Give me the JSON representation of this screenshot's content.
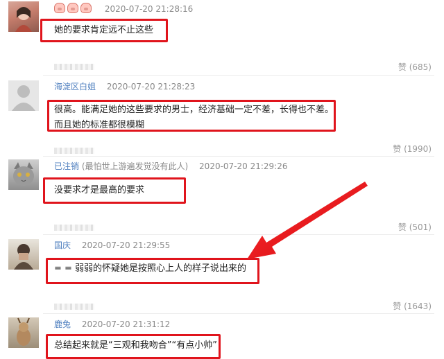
{
  "comments": [
    {
      "user": "",
      "note": "",
      "time": "2020-07-20 21:28:16",
      "content_lines": [
        "她的要求肯定远不止这些"
      ],
      "likes_label": "赞",
      "likes": "(685)",
      "badges": [
        "pig-emoji",
        "pig-emoji",
        "pig-emoji"
      ]
    },
    {
      "user": "海淀区白姐",
      "note": "",
      "time": "2020-07-20 21:28:23",
      "content_lines": [
        "很高。能满足她的这些要求的男士，经济基础一定不差，长得也不差。",
        "而且她的标准都很模糊"
      ],
      "likes_label": "赞",
      "likes": "(1990)"
    },
    {
      "user": "已注销",
      "note": "(最怕世上游遍发觉没有此人)",
      "time": "2020-07-20 21:29:26",
      "content_lines": [
        "没要求才是最高的要求"
      ],
      "likes_label": "赞",
      "likes": "(501)"
    },
    {
      "user": "国庆",
      "note": "",
      "time": "2020-07-20 21:29:55",
      "content_lines": [
        "= = 弱弱的怀疑她是按照心上人的样子说出来的"
      ],
      "likes_label": "赞",
      "likes": "(1643)"
    },
    {
      "user": "鹿兔",
      "note": "",
      "time": "2020-07-20 21:31:12",
      "content_lines": [
        "总结起来就是“三观和我吻合”“有点小帅”"
      ]
    }
  ],
  "colors": {
    "highlight_box": "#e0141c",
    "arrow": "#e0141c",
    "username": "#4f7fbf",
    "meta_text": "#888888"
  }
}
